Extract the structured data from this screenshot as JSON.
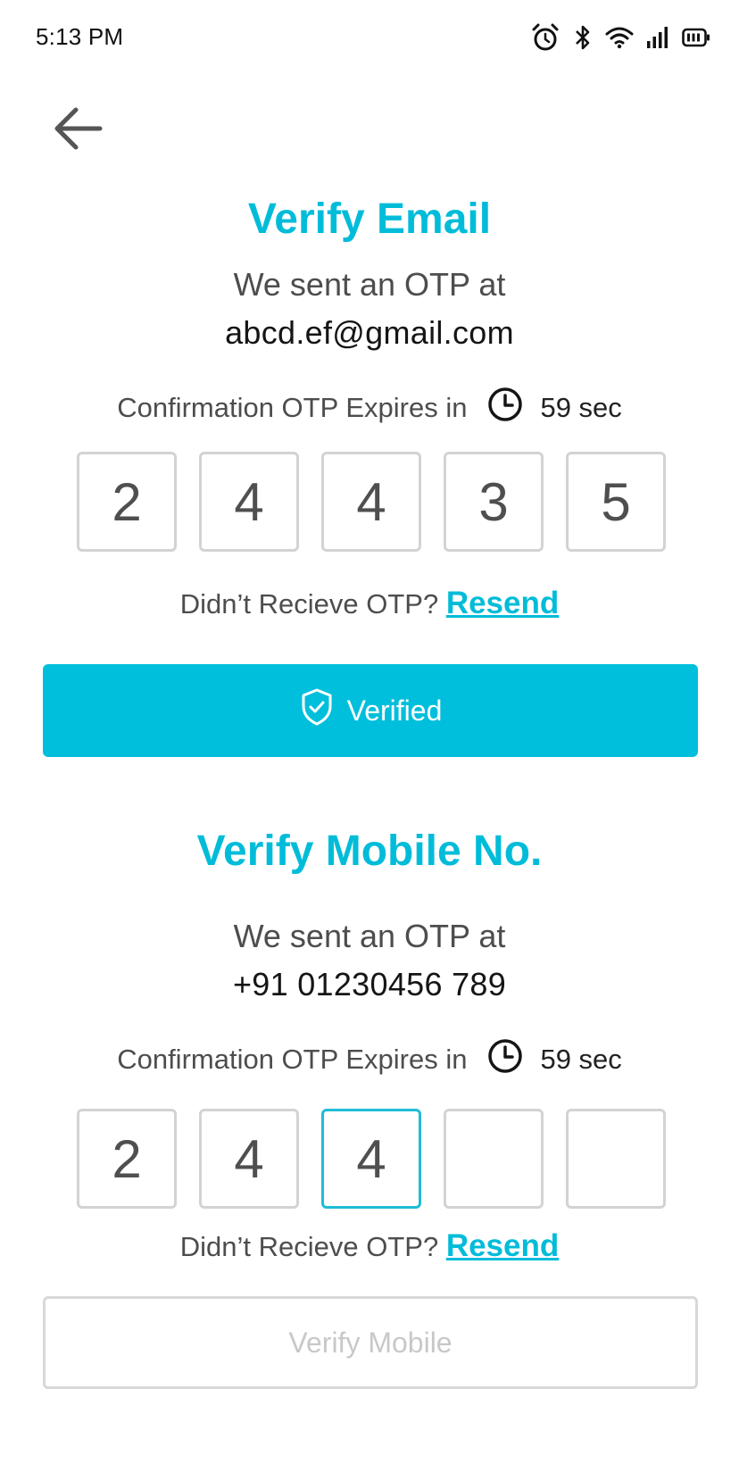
{
  "status_bar": {
    "time": "5:13 PM",
    "icons": [
      "alarm-icon",
      "bluetooth-icon",
      "wifi-icon",
      "signal-icon",
      "battery-icon"
    ]
  },
  "colors": {
    "accent": "#00bcd9",
    "button_bg": "#00bfdc",
    "box_border": "#d3d3d3",
    "disabled_text": "#c8c8c8"
  },
  "email_section": {
    "title": "Verify Email",
    "sent_text": "We sent an OTP at",
    "contact": "abcd.ef@gmail.com",
    "expires_label": "Confirmation OTP Expires in",
    "expires_value": "59 sec",
    "otp_digits": [
      "2",
      "4",
      "4",
      "3",
      "5"
    ],
    "resend_prompt": "Didn’t Recieve OTP?",
    "resend_label": "Resend",
    "button_label": "Verified"
  },
  "mobile_section": {
    "title": "Verify Mobile No.",
    "sent_text": "We sent an OTP at",
    "contact": "+91 01230456 789",
    "expires_label": "Confirmation OTP Expires in",
    "expires_value": "59 sec",
    "otp_digits": [
      "2",
      "4",
      "4",
      "",
      ""
    ],
    "resend_prompt": "Didn’t Recieve OTP?",
    "resend_label": "Resend",
    "button_label": "Verify Mobile"
  }
}
